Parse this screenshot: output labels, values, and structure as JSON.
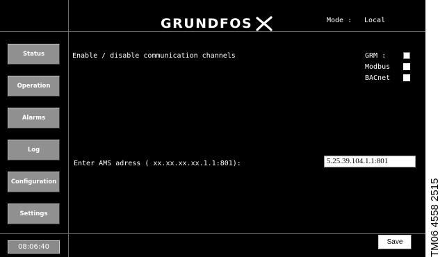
{
  "header": {
    "brand": "GRUNDFOS",
    "brand_icon": "grundfos-x-logo-icon",
    "mode_label": "Mode :",
    "mode_value": "Local"
  },
  "sidebar": {
    "buttons": [
      {
        "label": "Status"
      },
      {
        "label": "Operation"
      },
      {
        "label": "Alarms"
      },
      {
        "label": "Log"
      },
      {
        "label": "Configuration"
      },
      {
        "label": "Settings"
      }
    ],
    "clock": "08:06:40"
  },
  "main": {
    "enable_label": "Enable / disable communication channels",
    "channels": [
      {
        "label": "GRM :",
        "checked": false
      },
      {
        "label": "Modbus",
        "checked": false
      },
      {
        "label": "BACnet",
        "checked": false
      }
    ],
    "ams_label": "Enter AMS adress ( xx.xx.xx.xx.1.1:801):",
    "ams_value": "5.25.39.104.1.1:801",
    "save_label": "Save"
  },
  "document_code": "TM06 4558 2515",
  "colors": {
    "background": "#000000",
    "button_gray": "#909090",
    "divider": "#6a6a6a"
  }
}
